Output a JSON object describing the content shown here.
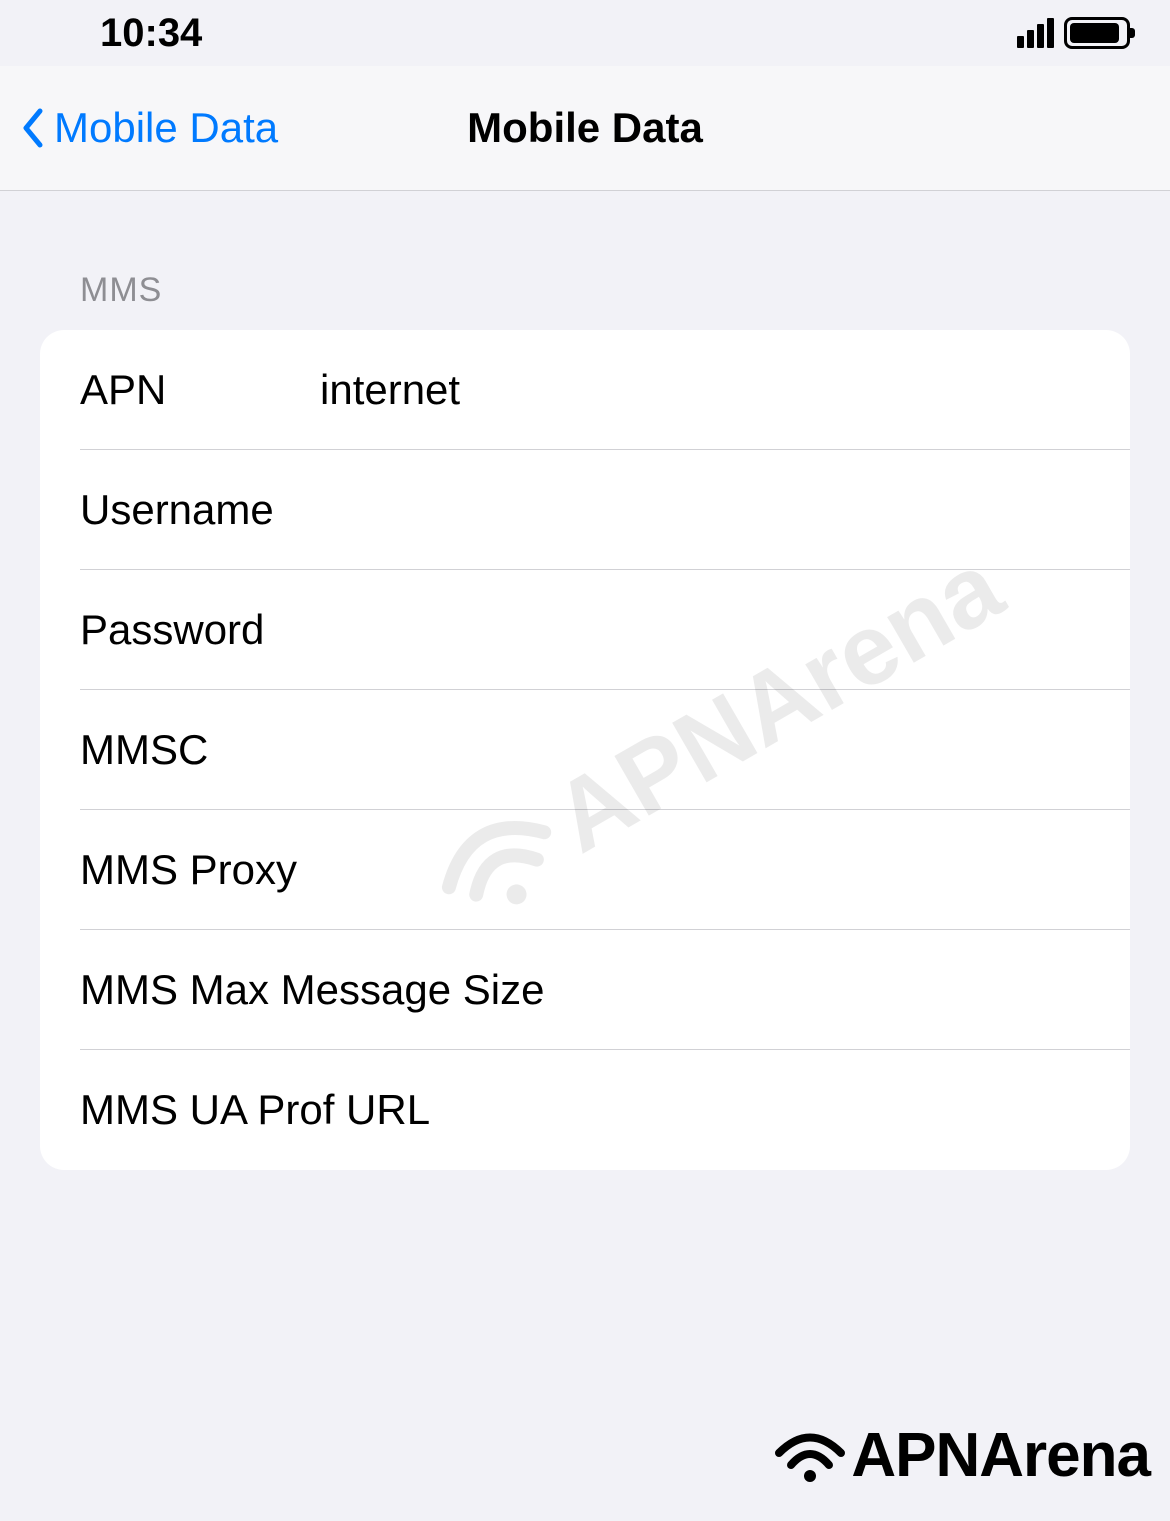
{
  "status": {
    "time": "10:34"
  },
  "nav": {
    "back_label": "Mobile Data",
    "title": "Mobile Data"
  },
  "section": {
    "header": "MMS"
  },
  "fields": {
    "apn": {
      "label": "APN",
      "value": "internet"
    },
    "username": {
      "label": "Username",
      "value": ""
    },
    "password": {
      "label": "Password",
      "value": ""
    },
    "mmsc": {
      "label": "MMSC",
      "value": ""
    },
    "mms_proxy": {
      "label": "MMS Proxy",
      "value": ""
    },
    "mms_max_size": {
      "label": "MMS Max Message Size",
      "value": ""
    },
    "mms_ua_prof": {
      "label": "MMS UA Prof URL",
      "value": ""
    }
  },
  "watermark": {
    "text": "APNArena"
  }
}
